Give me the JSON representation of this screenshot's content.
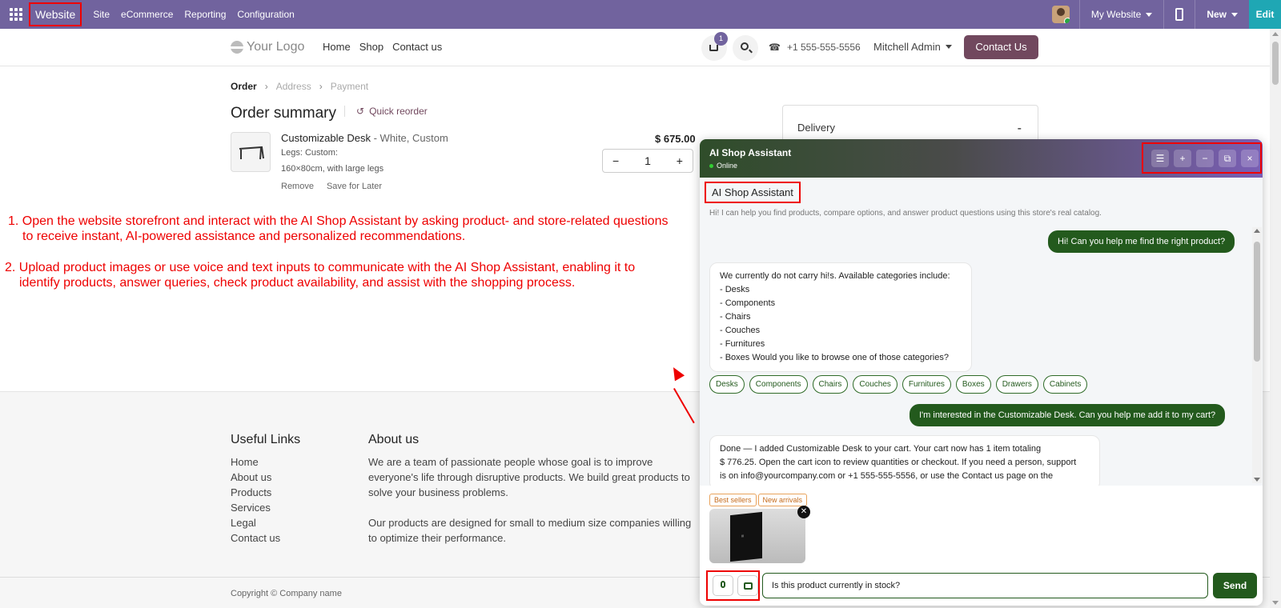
{
  "topbar": {
    "app": "Website",
    "menu": [
      "Site",
      "eCommerce",
      "Reporting",
      "Configuration"
    ],
    "website": "My Website",
    "new": "New",
    "edit": "Edit"
  },
  "header": {
    "logo": "Your Logo",
    "nav": [
      "Home",
      "Shop",
      "Contact us"
    ],
    "cart_count": "1",
    "phone": "+1 555-555-5556",
    "user": "Mitchell Admin",
    "contact_btn": "Contact Us"
  },
  "checkout": {
    "steps": [
      "Order",
      "Address",
      "Payment"
    ],
    "title": "Order summary",
    "quick_reorder": "Quick reorder",
    "product": {
      "name": "Customizable Desk",
      "variant": " - White, Custom",
      "legs": "Legs: Custom:",
      "size": "160×80cm, with large legs",
      "price": "$ 675.00",
      "qty": "1",
      "remove": "Remove",
      "save_later": "Save for Later"
    },
    "delivery_label": "Delivery",
    "delivery_value": "-"
  },
  "instructions": {
    "line1a": "1. Open the website storefront and interact with the AI Shop Assistant by asking product- and store-related questions",
    "line1b": "to receive instant, AI-powered assistance and personalized recommendations.",
    "line2a": "2. Upload product images or use voice and text inputs to communicate with the AI Shop Assistant, enabling it to",
    "line2b": "identify products, answer queries, check product availability, and assist with the shopping process."
  },
  "footer": {
    "links_title": "Useful Links",
    "links": [
      "Home",
      "About us",
      "Products",
      "Services",
      "Legal",
      "Contact us"
    ],
    "about_title": "About us",
    "about1": "We are a team of passionate people whose goal is to improve everyone's life through disruptive products. We build great products to solve your business problems.",
    "about2": "Our products are designed for small to medium size companies willing to optimize their performance.",
    "copyright": "Copyright © Company name"
  },
  "chat": {
    "title": "AI Shop Assistant",
    "status": "Online",
    "head_buttons": [
      "☰",
      "+",
      "−",
      "⧉",
      "×"
    ],
    "bot_name": "AI Shop Assistant",
    "intro": "Hi! I can help you find products, compare options, and answer product questions using this store's real catalog.",
    "msg_user1": "Hi! Can you help me find the right product?",
    "msg_bot1": [
      "We currently do not carry hi!s. Available categories include:",
      "- Desks",
      "- Components",
      "- Chairs",
      "- Couches",
      "- Furnitures",
      "- Boxes Would you like to browse one of those categories?"
    ],
    "chips": [
      "Desks",
      "Components",
      "Chairs",
      "Couches",
      "Furnitures",
      "Boxes",
      "Drawers",
      "Cabinets"
    ],
    "msg_user2": "I'm interested in the Customizable Desk. Can you help me add it to my cart?",
    "msg_bot2": [
      "Done — I added Customizable Desk to your cart. Your cart now has 1 item totaling",
      "$ 776.25. Open the cart icon to review quantities or checkout. If you need a person, support",
      "is on info@yourcompany.com or +1 555-555-5556, or use the Contact us page on the"
    ],
    "tags": [
      "Best sellers",
      "New arrivals"
    ],
    "input_value": "Is this product currently in stock?",
    "send": "Send"
  }
}
